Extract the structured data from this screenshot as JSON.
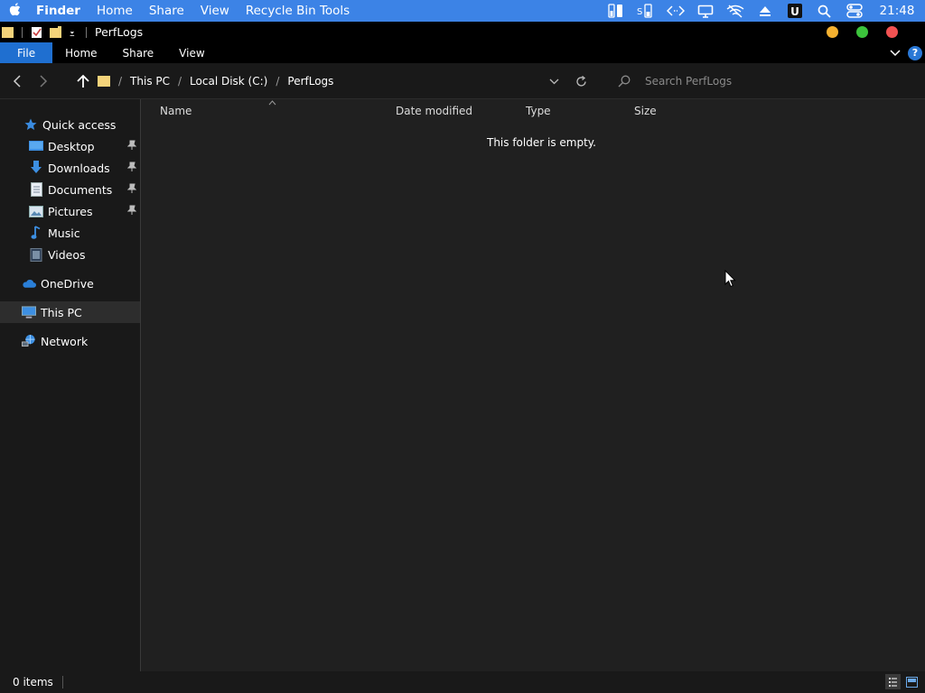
{
  "menubar": {
    "app": "Finder",
    "items": [
      "Home",
      "Share",
      "View",
      "Recycle Bin Tools"
    ],
    "clock": "21:48"
  },
  "window": {
    "title": "PerfLogs"
  },
  "ribbon": {
    "tabs": [
      "File",
      "Home",
      "Share",
      "View"
    ]
  },
  "address": {
    "crumbs": [
      "This PC",
      "Local Disk (C:)",
      "PerfLogs"
    ],
    "search_placeholder": "Search PerfLogs"
  },
  "sidebar": {
    "quick_access": "Quick access",
    "items": [
      {
        "label": "Desktop",
        "pinned": true
      },
      {
        "label": "Downloads",
        "pinned": true
      },
      {
        "label": "Documents",
        "pinned": true
      },
      {
        "label": "Pictures",
        "pinned": true
      },
      {
        "label": "Music",
        "pinned": false
      },
      {
        "label": "Videos",
        "pinned": false
      }
    ],
    "onedrive": "OneDrive",
    "this_pc": "This PC",
    "network": "Network"
  },
  "columns": [
    "Name",
    "Date modified",
    "Type",
    "Size"
  ],
  "empty_message": "This folder is empty.",
  "status": {
    "items": "0 items"
  },
  "colors": {
    "accent": "#3c83e6",
    "file_tab": "#1f6fd0",
    "traffic_yellow": "#f5b130",
    "traffic_green": "#3cc43c",
    "traffic_red": "#f25252"
  }
}
